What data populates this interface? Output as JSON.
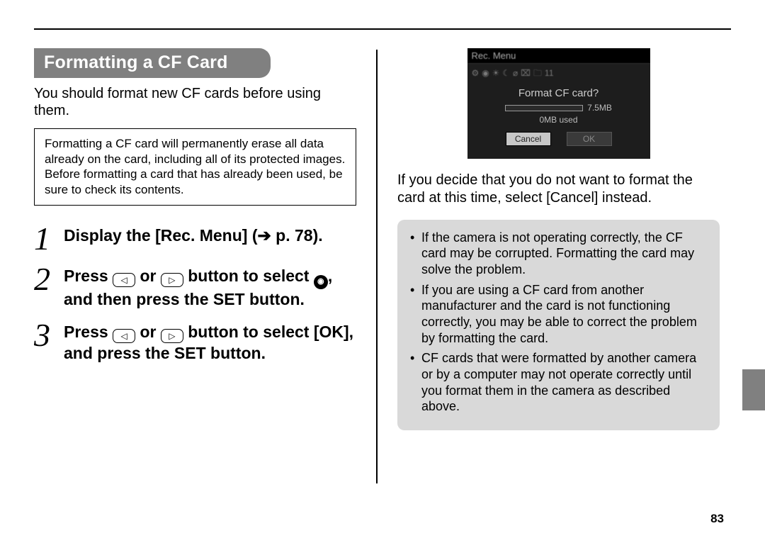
{
  "page_number": "83",
  "section_title": "Formatting a CF Card",
  "intro": "You should format new CF cards before using them.",
  "warning": "Formatting a CF card will permanently erase all data already on the card, including all of its protected images. Before formatting a card that has already been used, be sure to check its contents.",
  "steps": [
    {
      "num": "1",
      "text_pre": "Display the [Rec. Menu] (",
      "arrow": "➔",
      "text_post": " p. 78)."
    },
    {
      "num": "2",
      "text_a": "Press ",
      "text_b": " or ",
      "text_c": " button to select ",
      "text_d": ", and then press the SET button."
    },
    {
      "num": "3",
      "text_a": "Press ",
      "text_b": " or ",
      "text_c": " button to select [OK], and press the SET button."
    }
  ],
  "icons": {
    "left_tri": "◁",
    "right_tri": "▷",
    "camera_glyph": "◉"
  },
  "lcd": {
    "title": "Rec. Menu",
    "row": "⚙ ◉ ☀ ☾ ⌀ ⌧ 🗀 11",
    "question": "Format CF card?",
    "capacity": "7.5MB",
    "used": "0MB used",
    "cancel": "Cancel",
    "ok": "OK"
  },
  "right_paragraph": "If you decide that you do not want to format the card at this time, select [Cancel] instead.",
  "tips": [
    "If the camera is not operating correctly, the CF card may be corrupted. Formatting the card may solve the problem.",
    "If you are using a CF card from another manufacturer and the card is not functioning correctly, you may be able to correct the problem by formatting the card.",
    "CF cards that were formatted by another camera or by a computer may not operate correctly until you format them in the camera as described above."
  ]
}
